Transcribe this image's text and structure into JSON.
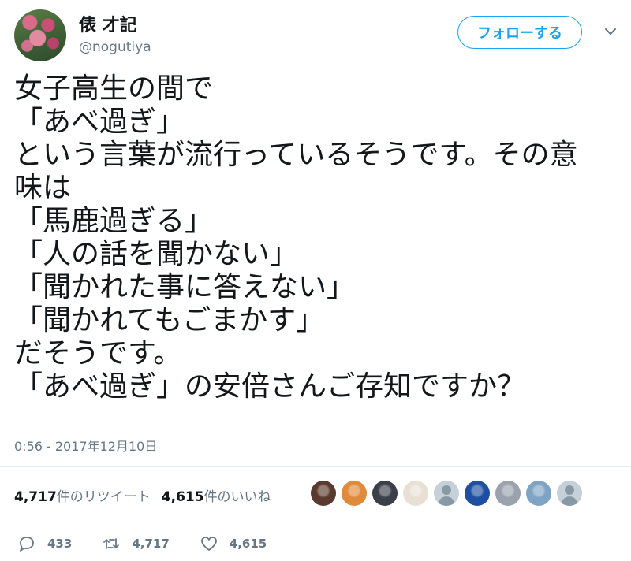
{
  "author": {
    "display_name": "俵 才記",
    "handle": "@nogutiya"
  },
  "follow_button": {
    "label": "フォローする"
  },
  "tweet": {
    "lines": [
      "女子高生の間で",
      "「あべ過ぎ」",
      "という言葉が流行っているそうです。その意",
      "味は",
      "「馬鹿過ぎる」",
      "「人の話を聞かない」",
      "「聞かれた事に答えない」",
      "「聞かれてもごまかす」",
      "だそうです。",
      "「あべ過ぎ」の安倍さんご存知ですか？"
    ],
    "timestamp": "0:56 - 2017年12月10日"
  },
  "stats": {
    "retweets_count": "4,717",
    "retweets_label": "件のリツイート",
    "likes_count": "4,615",
    "likes_label": "件のいいね"
  },
  "likers": [
    {
      "icon": "liker-avatar-1",
      "color": "#5a3a2e"
    },
    {
      "icon": "liker-avatar-2",
      "color": "#e08a3c"
    },
    {
      "icon": "liker-avatar-3",
      "color": "#3a3f4a"
    },
    {
      "icon": "liker-avatar-4",
      "color": "#e8e0d4"
    },
    {
      "icon": "default-avatar",
      "color": "#c6d0d8"
    },
    {
      "icon": "liker-avatar-6",
      "color": "#1f4fa0"
    },
    {
      "icon": "liker-avatar-7",
      "color": "#9aa3ad"
    },
    {
      "icon": "liker-avatar-8",
      "color": "#7fa3c4"
    },
    {
      "icon": "default-avatar",
      "color": "#c6d0d8"
    }
  ],
  "actions": {
    "reply_count": "433",
    "retweet_count": "4,717",
    "like_count": "4,615"
  },
  "colors": {
    "accent": "#1da1f2",
    "text": "#14171a",
    "secondary": "#657786"
  }
}
